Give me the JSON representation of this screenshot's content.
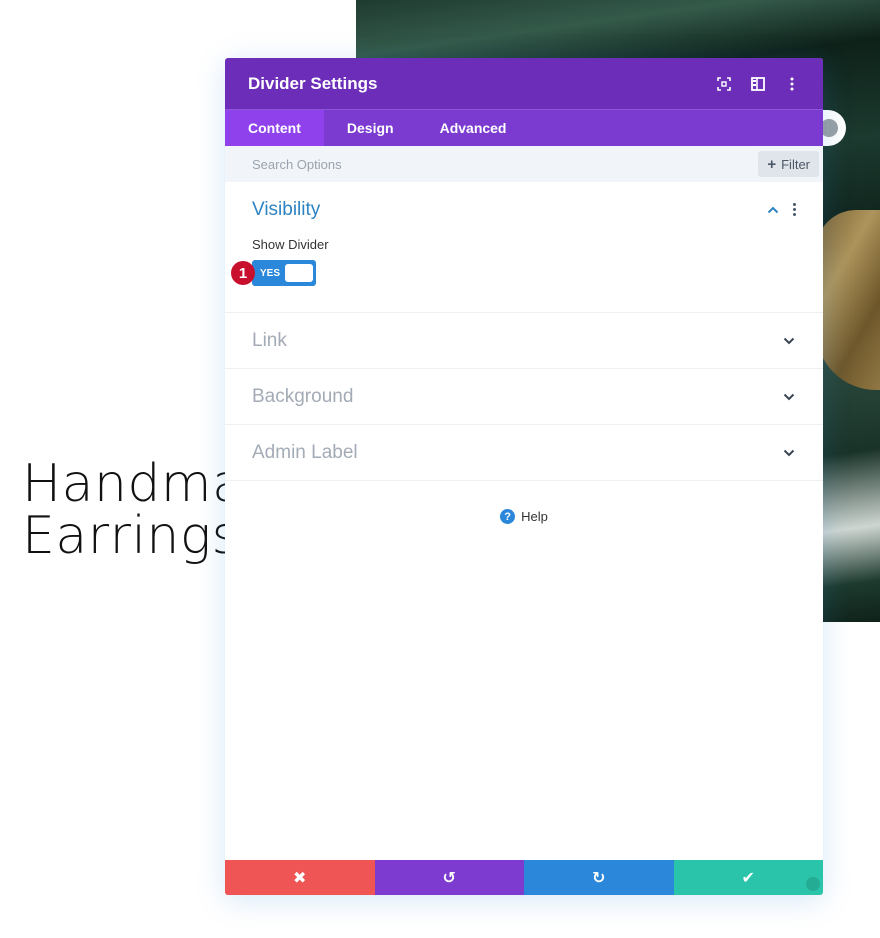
{
  "background_page": {
    "heading_lines": [
      "Handmade",
      "Earrings"
    ]
  },
  "modal": {
    "title": "Divider Settings",
    "header_icons": [
      "focus-mode-icon",
      "split-view-icon",
      "more-options-icon"
    ],
    "tabs": [
      {
        "label": "Content",
        "active": true
      },
      {
        "label": "Design",
        "active": false
      },
      {
        "label": "Advanced",
        "active": false
      }
    ],
    "search": {
      "placeholder": "Search Options",
      "value": ""
    },
    "filter_label": "Filter",
    "sections": [
      {
        "title": "Visibility",
        "open": true,
        "fields": [
          {
            "label": "Show Divider",
            "type": "toggle",
            "value": "YES",
            "on": true
          }
        ]
      },
      {
        "title": "Link",
        "open": false
      },
      {
        "title": "Background",
        "open": false
      },
      {
        "title": "Admin Label",
        "open": false
      }
    ],
    "help_label": "Help",
    "step_badge": "1",
    "footer": {
      "discard": "✖",
      "undo": "↺",
      "redo": "↻",
      "save": "✔"
    }
  },
  "colors": {
    "header": "#6c2eb9",
    "tabs": "#7b3bd0",
    "active_tab": "#8f42ec",
    "accent_blue": "#2b87da",
    "discard": "#ef5555",
    "undo": "#7e3bd0",
    "redo": "#2b87da",
    "save": "#29c4a9",
    "badge": "#c8102e"
  }
}
